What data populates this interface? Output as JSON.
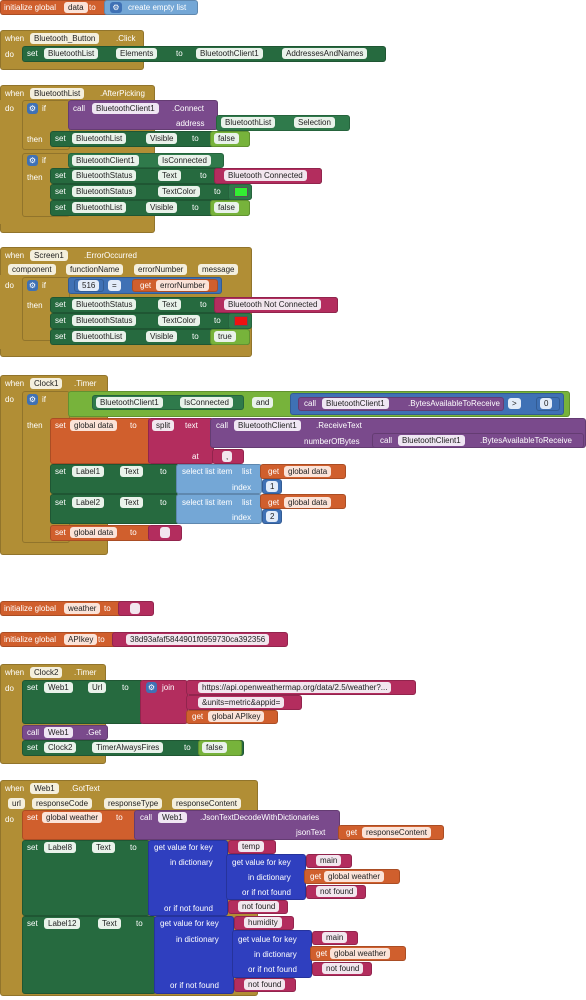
{
  "blocks": {
    "init_data": {
      "kw": "initialize global",
      "name": "data",
      "to": "to",
      "value": "create empty list"
    },
    "bt_click": {
      "when": "when",
      "component": "Bluetooth_Button",
      "event": ".Click",
      "do": "do",
      "set": "set",
      "target": "BluetoothList",
      "prop": "Elements",
      "to": "to",
      "src": "BluetoothClient1",
      "srcprop": "AddressesAndNames"
    },
    "after_picking": {
      "when": "when",
      "component": "BluetoothList",
      "event": ".AfterPicking",
      "do": "do",
      "if": "if",
      "then": "then",
      "call": "call",
      "client": "BluetoothClient1",
      "method": ".Connect",
      "address": "address",
      "list": "BluetoothList",
      "selection": "Selection",
      "visible": "Visible",
      "false": "false",
      "isconnected": "IsConnected",
      "status": "BluetoothStatus",
      "text": "Text",
      "connected": "Bluetooth Connected",
      "textcolor": "TextColor",
      "green": "#33ee33"
    },
    "error": {
      "when": "when",
      "component": "Screen1",
      "event": ".ErrorOccurred",
      "params": [
        "component",
        "functionName",
        "errorNumber",
        "message"
      ],
      "do": "do",
      "if": "if",
      "num": "516",
      "eq": "=",
      "get": "get",
      "errvar": "errorNumber",
      "then": "then",
      "notconn": "Bluetooth Not Connected",
      "red": "#ee1111",
      "true": "true"
    },
    "timer1": {
      "when": "when",
      "component": "Clock1",
      "event": ".Timer",
      "do": "do",
      "if": "if",
      "client": "BluetoothClient1",
      "isconnected": "IsConnected",
      "and": "and",
      "call": "call",
      "bytes": ".BytesAvailableToReceive",
      "gt": ">",
      "zero": "0",
      "then": "then",
      "set": "set",
      "gdata": "global data",
      "to": "to",
      "split": "split",
      "text": "text",
      "receive": ".ReceiveText",
      "numbytes": "numberOfBytes",
      "at": "at",
      "comma": ",",
      "label1": "Label1",
      "label2": "Label2",
      "textprop": "Text",
      "select": "select list item",
      "listkw": "list",
      "get": "get",
      "index": "index",
      "one": "1",
      "two": "2",
      "empty": ""
    },
    "init_weather": {
      "kw": "initialize global",
      "name": "weather",
      "to": "to"
    },
    "init_apikey": {
      "kw": "initialize global",
      "name": "APIkey",
      "to": "to",
      "value": "38d93afaf5844901f0959730ca392356"
    },
    "timer2": {
      "when": "when",
      "component": "Clock2",
      "event": ".Timer",
      "do": "do",
      "set": "set",
      "web": "Web1",
      "url": "Url",
      "to": "to",
      "join": "join",
      "url1": "https://api.openweathermap.org/data/2.5/weather?...",
      "url2": "&units=metric&appid=",
      "get": "get",
      "apikey": "global APIkey",
      "call": "call",
      "getm": ".Get",
      "clock": "Clock2",
      "always": "TimerAlwaysFires",
      "false": "false"
    },
    "gottext": {
      "when": "when",
      "component": "Web1",
      "event": ".GotText",
      "params": [
        "url",
        "responseCode",
        "responseType",
        "responseContent"
      ],
      "do": "do",
      "set": "set",
      "gweather": "global weather",
      "to": "to",
      "call": "call",
      "web": "Web1",
      "decode": ".JsonTextDecodeWithDictionaries",
      "jsontext": "jsonText",
      "get": "get",
      "rc": "responseContent",
      "label8": "Label8",
      "label12": "Label12",
      "textprop": "Text",
      "getval": "get value for key",
      "indict": "in dictionary",
      "notfound": "or if not found",
      "temp": "temp",
      "main": "main",
      "nf": "not found",
      "humidity": "humidity"
    }
  }
}
